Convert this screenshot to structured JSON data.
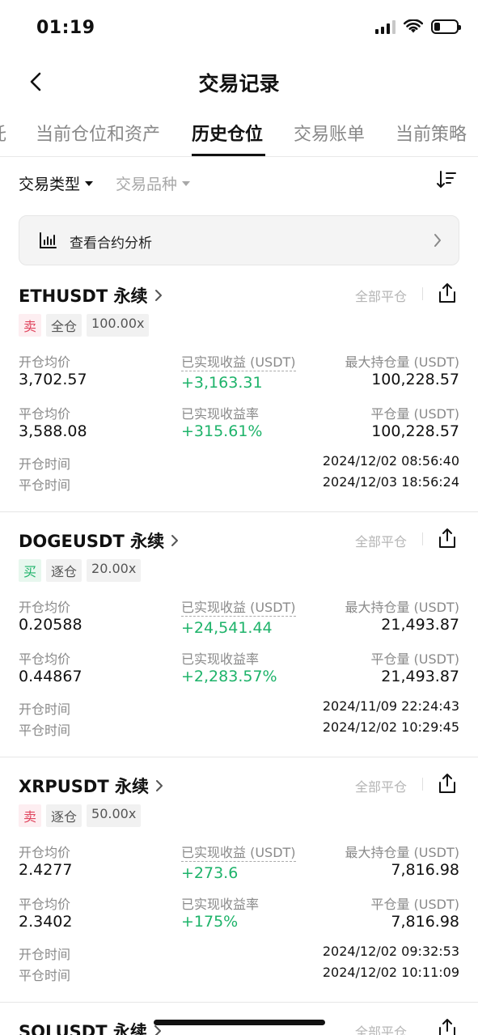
{
  "status_bar": {
    "time": "01:19"
  },
  "header": {
    "title": "交易记录"
  },
  "tabs": [
    {
      "label": "托"
    },
    {
      "label": "当前仓位和资产"
    },
    {
      "label": "历史仓位"
    },
    {
      "label": "交易账单"
    },
    {
      "label": "当前策略"
    }
  ],
  "filters": {
    "trade_type": "交易类型",
    "trade_symbol": "交易品种"
  },
  "analysis": {
    "label": "查看合约分析"
  },
  "labels": {
    "open_avg": "开仓均价",
    "realized_pnl": "已实现收益 (USDT)",
    "max_position": "最大持仓量 (USDT)",
    "close_avg": "平仓均价",
    "realized_rate": "已实现收益率",
    "close_amount": "平仓量 (USDT)",
    "open_time": "开仓时间",
    "close_time": "平仓时间",
    "close_all": "全部平仓"
  },
  "positions": [
    {
      "symbol": "ETHUSDT 永续",
      "side": "卖",
      "side_type": "sell",
      "margin": "全仓",
      "leverage": "100.00x",
      "open_avg": "3,702.57",
      "realized_pnl": "+3,163.31",
      "max_position": "100,228.57",
      "close_avg": "3,588.08",
      "realized_rate": "+315.61%",
      "close_amount": "100,228.57",
      "open_time": "2024/12/02 08:56:40",
      "close_time": "2024/12/03 18:56:24"
    },
    {
      "symbol": "DOGEUSDT 永续",
      "side": "买",
      "side_type": "buy",
      "margin": "逐仓",
      "leverage": "20.00x",
      "open_avg": "0.20588",
      "realized_pnl": "+24,541.44",
      "max_position": "21,493.87",
      "close_avg": "0.44867",
      "realized_rate": "+2,283.57%",
      "close_amount": "21,493.87",
      "open_time": "2024/11/09 22:24:43",
      "close_time": "2024/12/02 10:29:45"
    },
    {
      "symbol": "XRPUSDT 永续",
      "side": "卖",
      "side_type": "sell",
      "margin": "逐仓",
      "leverage": "50.00x",
      "open_avg": "2.4277",
      "realized_pnl": "+273.6",
      "max_position": "7,816.98",
      "close_avg": "2.3402",
      "realized_rate": "+175%",
      "close_amount": "7,816.98",
      "open_time": "2024/12/02 09:32:53",
      "close_time": "2024/12/02 10:11:09"
    },
    {
      "symbol": "SOLUSDT 永续"
    }
  ],
  "colors": {
    "green": "#1eb36a",
    "sell_red": "#e0455e"
  },
  "icons": {
    "back": "chevron-left-icon",
    "sort": "sort-icon",
    "chart": "bar-chart-icon",
    "share": "share-icon",
    "chevron": "chevron-right-icon"
  }
}
